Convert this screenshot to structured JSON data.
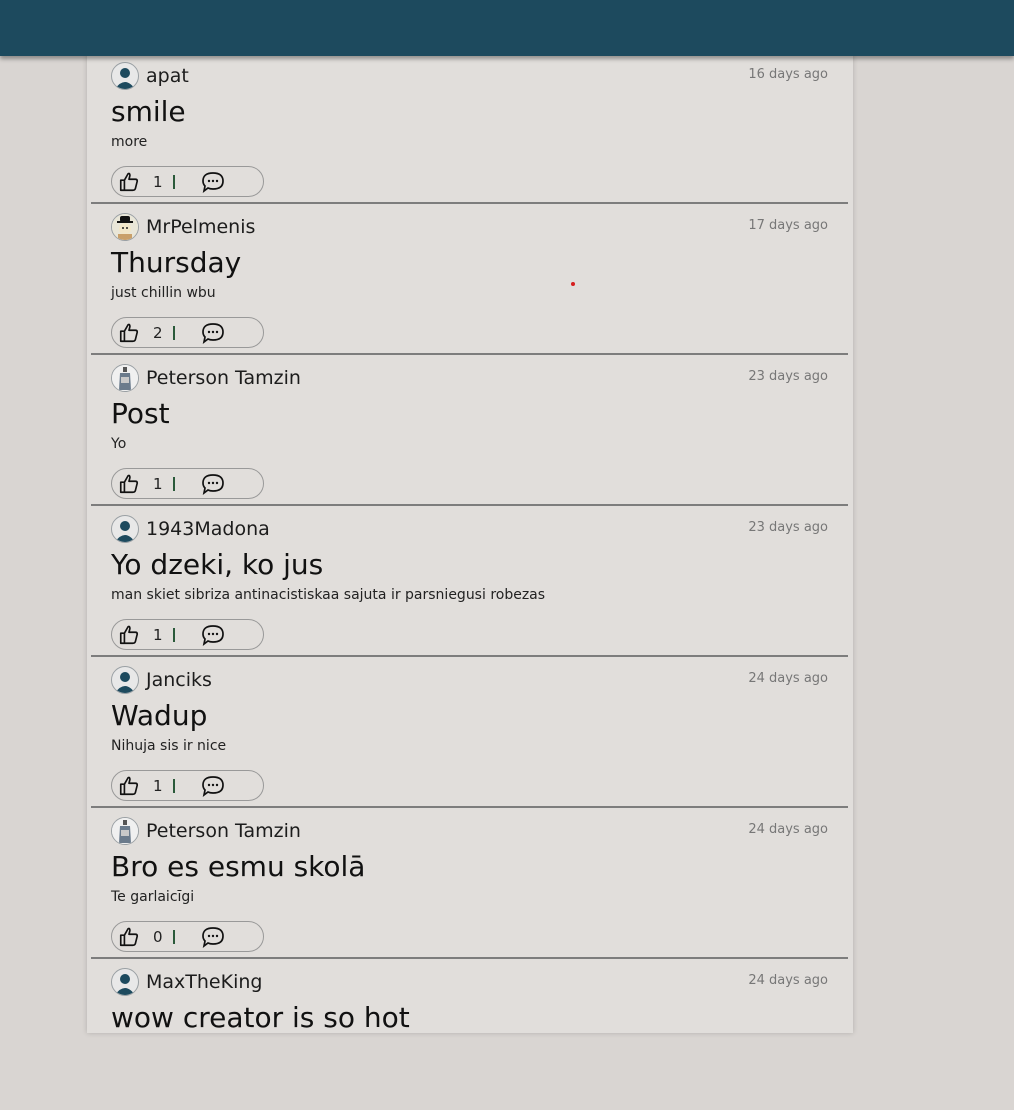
{
  "colors": {
    "topbar": "#1d4a5e",
    "page_background": "#d9d5d2",
    "feed_background": "#e1dedb",
    "divider": "#7d7d7d"
  },
  "posts": [
    {
      "author": "apat",
      "avatar": "default-avatar-icon",
      "time": "16 days ago",
      "title": "smile",
      "body": "more",
      "likes": "1"
    },
    {
      "author": "MrPelmenis",
      "avatar": "custom-avatar-image",
      "time": "17 days ago",
      "title": "Thursday",
      "body": "just chillin wbu",
      "likes": "2"
    },
    {
      "author": "Peterson Tamzin",
      "avatar": "custom-avatar-image",
      "time": "23 days ago",
      "title": "Post",
      "body": "Yo",
      "likes": "1"
    },
    {
      "author": "1943Madona",
      "avatar": "default-avatar-icon",
      "time": "23 days ago",
      "title": "Yo dzeki, ko jus",
      "body": "man skiet sibriza antinacistiskaa sajuta ir parsniegusi robezas",
      "likes": "1"
    },
    {
      "author": "Janciks",
      "avatar": "default-avatar-icon",
      "time": "24 days ago",
      "title": "Wadup",
      "body": "Nihuja sis ir nice",
      "likes": "1"
    },
    {
      "author": "Peterson Tamzin",
      "avatar": "custom-avatar-image",
      "time": "24 days ago",
      "title": "Bro es esmu skolā",
      "body": "Te garlaicīgi",
      "likes": "0"
    },
    {
      "author": "MaxTheKing",
      "avatar": "default-avatar-icon",
      "time": "24 days ago",
      "title": "wow creator is so hot",
      "body": "",
      "likes": ""
    }
  ]
}
